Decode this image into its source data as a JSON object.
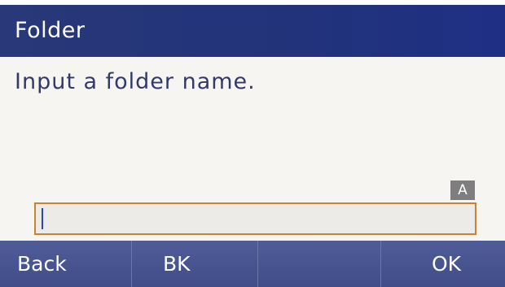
{
  "header": {
    "title": "Folder"
  },
  "dialog": {
    "prompt": "Input a folder name.",
    "input_mode": "A",
    "input_value": ""
  },
  "softkeys": [
    {
      "label": "Back"
    },
    {
      "label": "BK"
    },
    {
      "label": ""
    },
    {
      "label": "OK"
    }
  ],
  "colors": {
    "title_bar": "#22337a",
    "softkey_bar": "#46528e",
    "content_bg": "#f7f5f1",
    "prompt_text": "#313a6a",
    "input_border": "#c78437",
    "input_bg": "#ecebe8",
    "caret": "#2e46a6",
    "mode_badge": "#7e7e7e"
  }
}
